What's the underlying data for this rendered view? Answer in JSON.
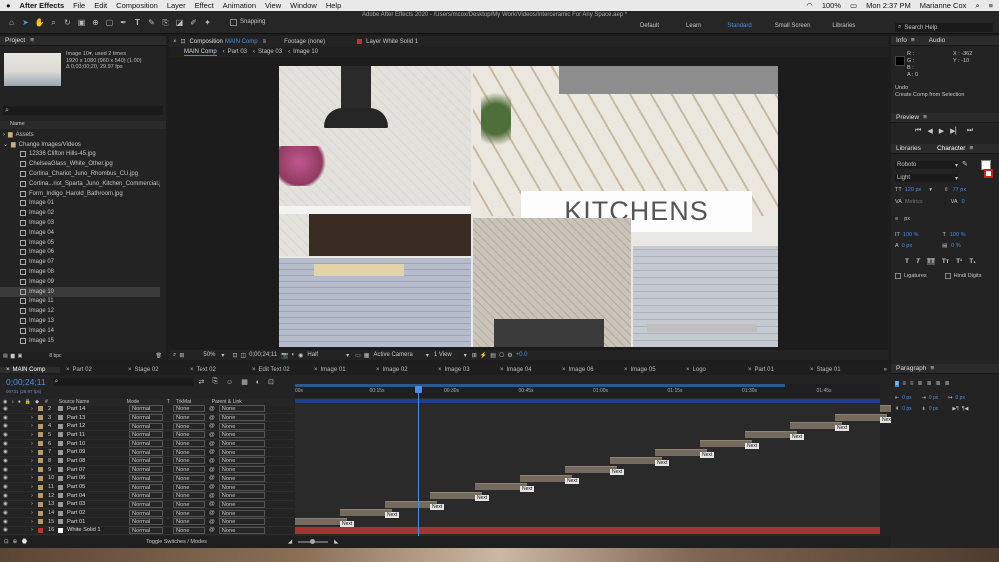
{
  "menubar": {
    "app": "After Effects",
    "items": [
      "File",
      "Edit",
      "Composition",
      "Layer",
      "Effect",
      "Animation",
      "View",
      "Window",
      "Help"
    ],
    "battery": "100%",
    "time": "Mon 2:37 PM",
    "user": "Marianne Cox"
  },
  "toolbar": {
    "snapping": "Snapping",
    "title": "Adobe After Effects 2020 - /Users/mcox/Desktop/My Work/Videos/Interceramic For Any Space.aep *",
    "workspaces": [
      "Default",
      "Learn",
      "Standard",
      "Small Screen",
      "Libraries"
    ],
    "active_workspace": "Standard",
    "search_placeholder": "Search Help"
  },
  "project": {
    "title": "Project",
    "preview_name": "Image 10",
    "used": ", used 2 times",
    "dims": "1920 x 1080 (960 x 540) (1.00)",
    "duration": "Δ 0;03;00;20, 29.97 fps",
    "search_placeholder": "",
    "col_name": "Name",
    "folders": [
      "Assets",
      "Change Images/Videos"
    ],
    "items": [
      "12336 Clifton Hills-45.jpg",
      "ChelseaGlass_White_Other.jpg",
      "Cortina_Chariot_Juno_Rhombus_CU.jpg",
      "Cortina...riot_Sparta_Juno_Kitchen_Commercial.jp",
      "Form_Indigo_Harold_Bathroom.jpg",
      "Image 01",
      "Image 02",
      "Image 03",
      "Image 04",
      "Image 05",
      "Image 06",
      "Image 07",
      "Image 08",
      "Image 09",
      "Image 10",
      "Image 11",
      "Image 12",
      "Image 13",
      "Image 14",
      "Image 15"
    ],
    "selected_item": "Image 10",
    "bpc": "8 bpc"
  },
  "comp": {
    "tab_label": "Composition",
    "comp_name": "MAIN Comp",
    "footage": "Footage (none)",
    "layer": "Layer White Solid 1",
    "breadcrumbs": [
      "MAIN Comp",
      "Part 03",
      "Stage 03",
      "Image 10"
    ],
    "overlay_text": "KITCHENS",
    "zoom": "50%",
    "timecode": "0;00;24;11",
    "resolution": "Half",
    "camera": "Active Camera",
    "views": "1 View",
    "exposure": "+0.0"
  },
  "info": {
    "title": "Info",
    "audio": "Audio",
    "r": "R :",
    "g": "G :",
    "b": "B :",
    "a": "A : 0",
    "x": "X : -362",
    "y": "Y : -10",
    "undo": "Undo",
    "undo_action": "Create Comp from Selection"
  },
  "preview": {
    "title": "Preview"
  },
  "character": {
    "libraries": "Libraries",
    "title": "Character",
    "font": "Roboto",
    "style": "Light",
    "size": "120 px",
    "leading": "77 px",
    "kerning": "Metrics",
    "tracking": "0",
    "stroke": "px",
    "vscale": "100 %",
    "hscale": "100 %",
    "baseline": "0 px",
    "tsume": "0 %",
    "ligatures": "Ligatures",
    "hindi": "Hindi Digits"
  },
  "paragraph": {
    "title": "Paragraph",
    "v1": "0 px",
    "v2": "0 px",
    "v3": "0 px",
    "v4": "0 px",
    "v5": "0 px"
  },
  "timeline": {
    "tabs": [
      "MAIN Comp",
      "Part 02",
      "Stage 02",
      "Text 02",
      "Edit Text 02",
      "Image 01",
      "Image 02",
      "Image 03",
      "Image 04",
      "Image 06",
      "Image 05",
      "Logo",
      "Part 01",
      "Stage 01"
    ],
    "timecode": "0;00;24;11",
    "frame_info": "00731 (29.97 fps)",
    "col_hash": "#",
    "col_source": "Source Name",
    "col_mode": "Mode",
    "col_t": "T",
    "col_trkmat": "TrkMat",
    "col_parent": "Parent & Link",
    "ruler": [
      "00s",
      "00:15s",
      "00:30s",
      "00:45s",
      "01:00s",
      "01:15s",
      "01:30s",
      "01:45s"
    ],
    "layers": [
      {
        "num": "2",
        "name": "Part 14"
      },
      {
        "num": "3",
        "name": "Part 13"
      },
      {
        "num": "4",
        "name": "Part 12"
      },
      {
        "num": "5",
        "name": "Part 11"
      },
      {
        "num": "6",
        "name": "Part 10"
      },
      {
        "num": "7",
        "name": "Part 09"
      },
      {
        "num": "8",
        "name": "Part 08"
      },
      {
        "num": "9",
        "name": "Part 07"
      },
      {
        "num": "10",
        "name": "Part 06"
      },
      {
        "num": "11",
        "name": "Part 05"
      },
      {
        "num": "12",
        "name": "Part 04"
      },
      {
        "num": "13",
        "name": "Part 03"
      },
      {
        "num": "14",
        "name": "Part 02"
      },
      {
        "num": "15",
        "name": "Part 01"
      },
      {
        "num": "16",
        "name": "White Solid 1"
      }
    ],
    "mode": "Normal",
    "none": "None",
    "marker": "Next",
    "toggle": "Toggle Switches / Modes"
  },
  "colors": {
    "accent": "#2d8ceb",
    "bar": "#746a5d",
    "solid": "#a33434"
  }
}
